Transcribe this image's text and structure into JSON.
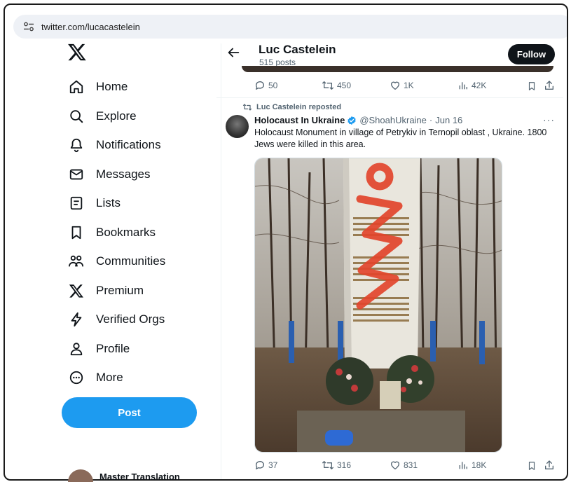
{
  "browser": {
    "url": "twitter.com/lucacastelein"
  },
  "nav": {
    "items": [
      {
        "label": "Home",
        "icon": "home-icon"
      },
      {
        "label": "Explore",
        "icon": "search-icon"
      },
      {
        "label": "Notifications",
        "icon": "bell-icon"
      },
      {
        "label": "Messages",
        "icon": "envelope-icon"
      },
      {
        "label": "Lists",
        "icon": "list-icon"
      },
      {
        "label": "Bookmarks",
        "icon": "bookmark-icon"
      },
      {
        "label": "Communities",
        "icon": "people-icon"
      },
      {
        "label": "Premium",
        "icon": "x-logo-icon"
      },
      {
        "label": "Verified Orgs",
        "icon": "lightning-icon"
      },
      {
        "label": "Profile",
        "icon": "person-icon"
      },
      {
        "label": "More",
        "icon": "more-circle-icon"
      }
    ],
    "post_label": "Post",
    "account_name": "Master Translation"
  },
  "profile": {
    "name": "Luc Castelein",
    "post_count": "515 posts",
    "follow_label": "Follow"
  },
  "prev_tweet_stats": {
    "replies": "50",
    "reposts": "450",
    "likes": "1K",
    "views": "42K"
  },
  "tweet": {
    "repost_label": "Luc Castelein reposted",
    "display_name": "Holocaust In Ukraine",
    "handle": "@ShoahUkraine",
    "sep": "·",
    "date": "Jun 16",
    "text": "Holocaust Monument in village of Petrykiv in Ternopil oblast , Ukraine. 1800 Jews were killed in this area.",
    "more_label": "···",
    "stats": {
      "replies": "37",
      "reposts": "316",
      "likes": "831",
      "views": "18K"
    }
  },
  "colors": {
    "accent": "#1d9bf0",
    "text": "#0f1419",
    "muted": "#536471",
    "graffiti": "#e2452c"
  }
}
